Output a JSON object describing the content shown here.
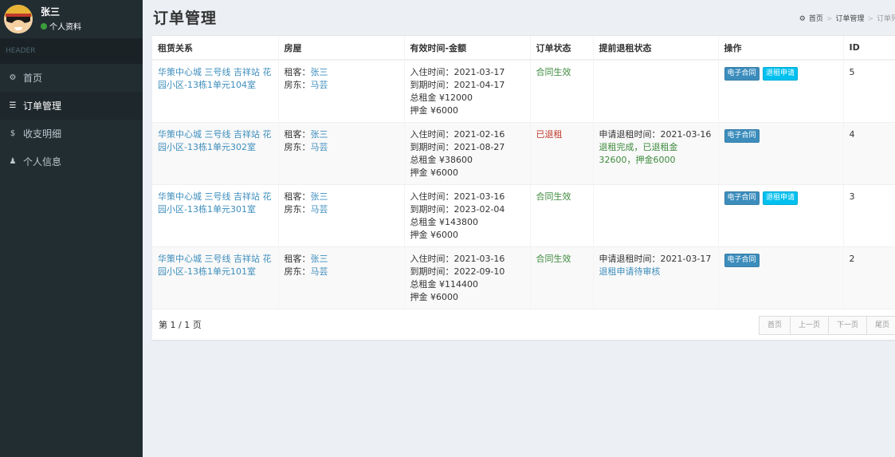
{
  "user": {
    "name": "张三",
    "status": "个人资料"
  },
  "sidebar": {
    "header": "HEADER",
    "items": [
      {
        "label": "首页",
        "icon": "dashboard-icon",
        "glyph": "⚙",
        "active": false
      },
      {
        "label": "订单管理",
        "icon": "database-icon",
        "glyph": "☰",
        "active": true
      },
      {
        "label": "收支明细",
        "icon": "dollar-icon",
        "glyph": "$",
        "active": false
      },
      {
        "label": "个人信息",
        "icon": "user-icon",
        "glyph": "♟",
        "active": false
      }
    ]
  },
  "page": {
    "title": "订单管理",
    "breadcrumb": {
      "home": "首页",
      "section": "订单管理",
      "current": "订单列"
    }
  },
  "table": {
    "headers": [
      "租赁关系",
      "房屋",
      "有效时间-金额",
      "订单状态",
      "提前退租状态",
      "操作",
      "ID"
    ],
    "tenant_label": "租客：",
    "landlord_label": "房东：",
    "rows": [
      {
        "property": "华策中心城 三号线 吉祥站 花园小区-13栋1单元104室",
        "tenant": "张三",
        "landlord": "马芸",
        "checkin": "入住时间：2021-03-17",
        "expire": "到期时间：2021-04-17",
        "total": "总租金 ¥12000",
        "deposit": "押金 ¥6000",
        "status": "合同生效",
        "status_color": "green",
        "refund_time": "",
        "refund_status": "",
        "contract_btn": "电子合同",
        "refund_btn": "退租申请",
        "id": "5"
      },
      {
        "property": "华策中心城 三号线 吉祥站 花园小区-13栋1单元302室",
        "tenant": "张三",
        "landlord": "马芸",
        "checkin": "入住时间：2021-02-16",
        "expire": "到期时间：2021-08-27",
        "total": "总租金 ¥38600",
        "deposit": "押金 ¥6000",
        "status": "已退租",
        "status_color": "red",
        "refund_time": "申请退租时间：2021-03-16",
        "refund_status": "退租完成，已退租金32600，押金6000",
        "contract_btn": "电子合同",
        "refund_btn": "",
        "id": "4"
      },
      {
        "property": "华策中心城 三号线 吉祥站 花园小区-13栋1单元301室",
        "tenant": "张三",
        "landlord": "马芸",
        "checkin": "入住时间：2021-03-16",
        "expire": "到期时间：2023-02-04",
        "total": "总租金 ¥143800",
        "deposit": "押金 ¥6000",
        "status": "合同生效",
        "status_color": "green",
        "refund_time": "",
        "refund_status": "",
        "contract_btn": "电子合同",
        "refund_btn": "退租申请",
        "id": "3"
      },
      {
        "property": "华策中心城 三号线 吉祥站 花园小区-13栋1单元101室",
        "tenant": "张三",
        "landlord": "马芸",
        "checkin": "入住时间：2021-03-16",
        "expire": "到期时间：2022-09-10",
        "total": "总租金 ¥114400",
        "deposit": "押金 ¥6000",
        "status": "合同生效",
        "status_color": "green",
        "refund_time": "申请退租时间：2021-03-17",
        "refund_status": "退租申请待审核",
        "contract_btn": "电子合同",
        "refund_btn": "",
        "id": "2"
      }
    ]
  },
  "pagination": {
    "page_info": "第 1 / 1 页",
    "first": "首页",
    "prev": "上一页",
    "next": "下一页",
    "last": "尾页"
  },
  "colors": {
    "sidebar_bg": "#222d32",
    "link": "#3c8dbc",
    "green": "#3d8a3d",
    "red": "#c0392b",
    "btn_primary": "#3c8dbc",
    "btn_info": "#00c0ef"
  }
}
